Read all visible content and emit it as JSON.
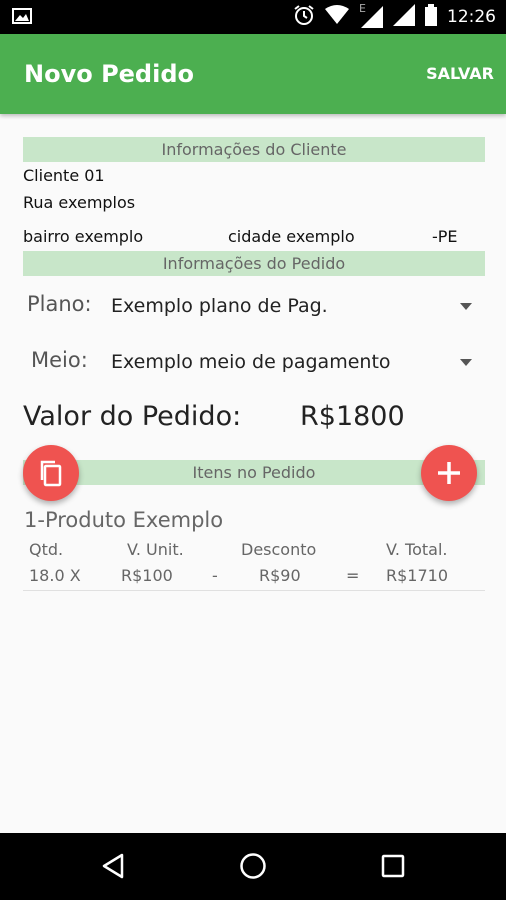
{
  "status_bar": {
    "time": "12:26",
    "network_letter": "E",
    "icons": [
      "image-icon",
      "alarm-icon",
      "wifi-icon",
      "signal-icon",
      "signal-icon",
      "battery-icon"
    ]
  },
  "app_bar": {
    "title": "Novo Pedido",
    "save_label": "SALVAR",
    "color": "#4caf50"
  },
  "client_section": {
    "header": "Informações do Cliente",
    "name": "Cliente 01",
    "street": "Rua exemplos",
    "neighborhood": "bairro exemplo",
    "city": "cidade exemplo",
    "state": "-PE"
  },
  "order_section": {
    "header": "Informações do Pedido",
    "plan_label": "Plano:",
    "plan_value": "Exemplo plano de Pag.",
    "method_label": "Meio:",
    "method_value": "Exemplo meio de pagamento",
    "total_label": "Valor do Pedido:",
    "total_value": "R$1800"
  },
  "items_section": {
    "header": "Itens no Pedido",
    "items": [
      {
        "title": "1-Produto Exemplo",
        "qty_header": "Qtd.",
        "unit_header": "V. Unit.",
        "discount_header": "Desconto",
        "total_header": "V. Total.",
        "qty": "18.0 X",
        "unit": "R$100",
        "minus": "-",
        "discount": "R$90",
        "equals": "=",
        "total": "R$1710"
      }
    ]
  },
  "fab": {
    "copy_icon": "copy-icon",
    "add_icon": "add-icon",
    "color": "#ef5350"
  },
  "nav_bar": {
    "icons": [
      "back-icon",
      "home-icon",
      "recents-icon"
    ]
  }
}
